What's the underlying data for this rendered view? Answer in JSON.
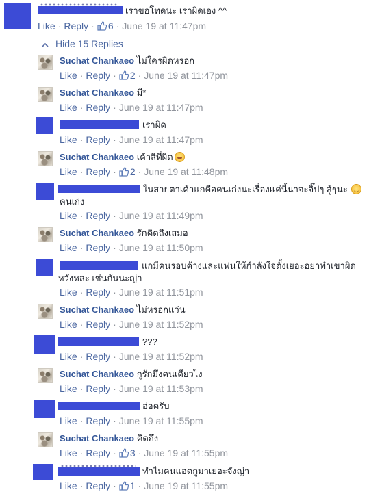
{
  "ui": {
    "like": "Like",
    "reply": "Reply",
    "dot": "·",
    "hide_replies": "Hide 15 Replies",
    "colors": {
      "link": "#365899",
      "meta": "#90949c",
      "redaction": "#3c4bd6"
    }
  },
  "top_comment": {
    "text": "เราขอโทดนะ เราผิดเอง ^^",
    "likes": "6",
    "time": "June 19 at 11:47pm"
  },
  "replies": [
    {
      "author": "Suchat Chankaeo",
      "text": "ไม่ใครผิดหรอก",
      "likes": "2",
      "time": "June 19 at 11:47pm"
    },
    {
      "author": "Suchat Chankaeo",
      "text": "มี*",
      "time": "June 19 at 11:47pm"
    },
    {
      "text": "เราผิด",
      "time": "June 19 at 11:47pm"
    },
    {
      "author": "Suchat Chankaeo",
      "text": "เค้าสิที่ผิด",
      "emoji": "crying-face-emoji",
      "likes": "2",
      "time": "June 19 at 11:48pm"
    },
    {
      "text_line1": "ในสายตาเค้าแกคือคนเก่งนะเรื่องแค่นี้น่าจะจิ๊ปๆ สู้ๆนะ",
      "emoji": "smiling-face-emoji",
      "text_line2": "คนเก่ง",
      "time": "June 19 at 11:49pm"
    },
    {
      "author": "Suchat Chankaeo",
      "text": "รักคิดถึงเสมอ",
      "time": "June 19 at 11:50pm"
    },
    {
      "text_line1": "แกมีคนรอบค้างและแฟนให้กำลังใจตั้งเยอะอย่าทำเขาผิด",
      "text_line2": "หวังหละ เช่นกันนะญ่า",
      "time": "June 19 at 11:51pm"
    },
    {
      "author": "Suchat Chankaeo",
      "text": "ไม่หรอกแว่น",
      "time": "June 19 at 11:52pm"
    },
    {
      "text": "???",
      "time": "June 19 at 11:52pm"
    },
    {
      "author": "Suchat Chankaeo",
      "text": "กูรักมึงคนเดียวไง",
      "time": "June 19 at 11:53pm"
    },
    {
      "text": "อ่อครับ",
      "time": "June 19 at 11:55pm"
    },
    {
      "author": "Suchat Chankaeo",
      "text": "คิดถึง",
      "likes": "3",
      "time": "June 19 at 11:55pm"
    },
    {
      "text": "ทำไมคนแอดกูมาเยอะจังญ่า",
      "likes": "1",
      "time": "June 19 at 11:55pm"
    }
  ]
}
